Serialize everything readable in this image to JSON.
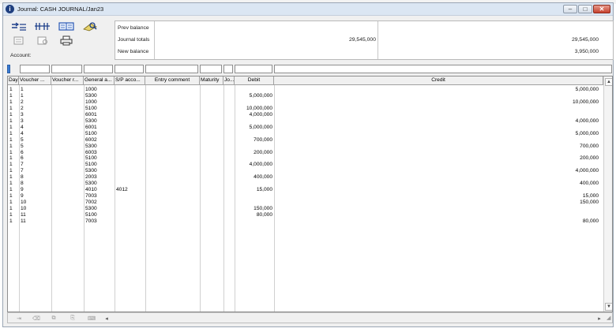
{
  "window": {
    "title": "Journal: CASH JOURNAL/Jan23",
    "icon": "info-icon",
    "controls": {
      "minimize": "–",
      "maximize": "□",
      "close": "✕"
    }
  },
  "toolbar": {
    "row1": [
      "journal-list-icon",
      "sort-icon",
      "book-icon",
      "search-icon"
    ],
    "row2": [
      "preview-icon",
      "zoom-icon",
      "print-icon"
    ]
  },
  "info_panel": {
    "prev_balance_label": "Prev balance",
    "journal_totals_label": "Journal totals",
    "new_balance_label": "New balance",
    "journal_totals_debit": "29,545,000",
    "journal_totals_credit": "29,545,000",
    "new_balance_credit": "3,950,000"
  },
  "account_label": "Account:",
  "grid": {
    "headers": {
      "day": "Day",
      "voucher": "Voucher ...",
      "voucher_ref": "Voucher r...",
      "general_account": "General a...",
      "sp_account": "S/P acco...",
      "entry_comment": "Entry comment",
      "maturity": "Maturity",
      "jo": "Jo...",
      "debit": "Debit",
      "credit": "Credit"
    },
    "rows": [
      {
        "day": "1",
        "voucher": "1",
        "account": "1000",
        "sp": "",
        "debit": "",
        "credit": "5,000,000"
      },
      {
        "day": "1",
        "voucher": "1",
        "account": "5300",
        "sp": "",
        "debit": "5,000,000",
        "credit": ""
      },
      {
        "day": "1",
        "voucher": "2",
        "account": "1000",
        "sp": "",
        "debit": "",
        "credit": "10,000,000"
      },
      {
        "day": "1",
        "voucher": "2",
        "account": "5100",
        "sp": "",
        "debit": "10,000,000",
        "credit": ""
      },
      {
        "day": "1",
        "voucher": "3",
        "account": "6001",
        "sp": "",
        "debit": "4,000,000",
        "credit": ""
      },
      {
        "day": "1",
        "voucher": "3",
        "account": "5300",
        "sp": "",
        "debit": "",
        "credit": "4,000,000"
      },
      {
        "day": "1",
        "voucher": "4",
        "account": "6001",
        "sp": "",
        "debit": "5,000,000",
        "credit": ""
      },
      {
        "day": "1",
        "voucher": "4",
        "account": "5100",
        "sp": "",
        "debit": "",
        "credit": "5,000,000"
      },
      {
        "day": "1",
        "voucher": "5",
        "account": "6002",
        "sp": "",
        "debit": "700,000",
        "credit": ""
      },
      {
        "day": "1",
        "voucher": "5",
        "account": "5300",
        "sp": "",
        "debit": "",
        "credit": "700,000"
      },
      {
        "day": "1",
        "voucher": "6",
        "account": "6003",
        "sp": "",
        "debit": "200,000",
        "credit": ""
      },
      {
        "day": "1",
        "voucher": "6",
        "account": "5100",
        "sp": "",
        "debit": "",
        "credit": "200,000"
      },
      {
        "day": "1",
        "voucher": "7",
        "account": "5100",
        "sp": "",
        "debit": "4,000,000",
        "credit": ""
      },
      {
        "day": "1",
        "voucher": "7",
        "account": "5300",
        "sp": "",
        "debit": "",
        "credit": "4,000,000"
      },
      {
        "day": "1",
        "voucher": "8",
        "account": "2003",
        "sp": "",
        "debit": "400,000",
        "credit": ""
      },
      {
        "day": "1",
        "voucher": "8",
        "account": "5300",
        "sp": "",
        "debit": "",
        "credit": "400,000"
      },
      {
        "day": "1",
        "voucher": "9",
        "account": "4010",
        "sp": "4012",
        "debit": "15,000",
        "credit": ""
      },
      {
        "day": "1",
        "voucher": "9",
        "account": "7003",
        "sp": "",
        "debit": "",
        "credit": "15,000"
      },
      {
        "day": "1",
        "voucher": "10",
        "account": "7002",
        "sp": "",
        "debit": "",
        "credit": "150,000"
      },
      {
        "day": "1",
        "voucher": "10",
        "account": "5300",
        "sp": "",
        "debit": "150,000",
        "credit": ""
      },
      {
        "day": "1",
        "voucher": "11",
        "account": "5100",
        "sp": "",
        "debit": "80,000",
        "credit": ""
      },
      {
        "day": "1",
        "voucher": "11",
        "account": "7003",
        "sp": "",
        "debit": "",
        "credit": "80,000"
      }
    ]
  },
  "bottom_bar": {
    "icons": [
      "insert-row-icon",
      "delete-row-icon",
      "copy-icon",
      "attach-icon",
      "calculator-icon"
    ],
    "scroll_left": "◂",
    "scroll_right": "▸"
  }
}
